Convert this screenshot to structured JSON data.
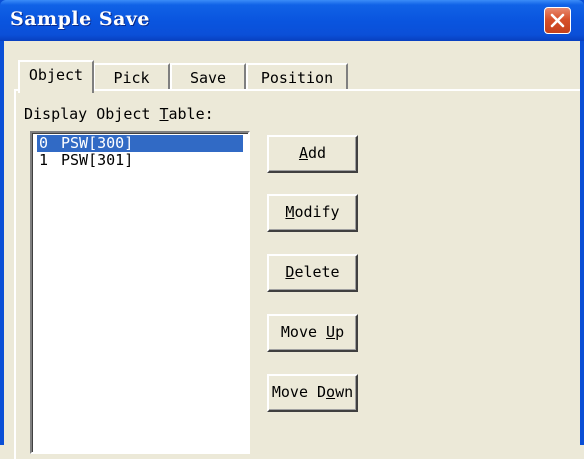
{
  "window": {
    "title": "Sample Save"
  },
  "tabs": [
    {
      "label": "Object",
      "active": true
    },
    {
      "label": "Pick",
      "active": false
    },
    {
      "label": "Save",
      "active": false
    },
    {
      "label": "Position",
      "active": false
    }
  ],
  "object_panel": {
    "table_label_prefix": "Display Object ",
    "table_label_accel": "T",
    "table_label_suffix": "able:",
    "list_items": [
      {
        "index": "0",
        "name": "PSW[300]",
        "selected": true
      },
      {
        "index": "1",
        "name": "PSW[301]",
        "selected": false
      }
    ]
  },
  "buttons": {
    "add": {
      "before": "",
      "accel": "A",
      "after": "dd"
    },
    "modify": {
      "before": "",
      "accel": "M",
      "after": "odify"
    },
    "delete": {
      "before": "",
      "accel": "D",
      "after": "elete"
    },
    "move_up": {
      "before": "Move ",
      "accel": "U",
      "after": "p"
    },
    "move_down": {
      "before": "Move D",
      "accel": "o",
      "after": "wn"
    }
  },
  "colors": {
    "titlebar": "#0a55df",
    "selection": "#316ac5",
    "face": "#ece9d8",
    "close_button": "#d7512b"
  }
}
